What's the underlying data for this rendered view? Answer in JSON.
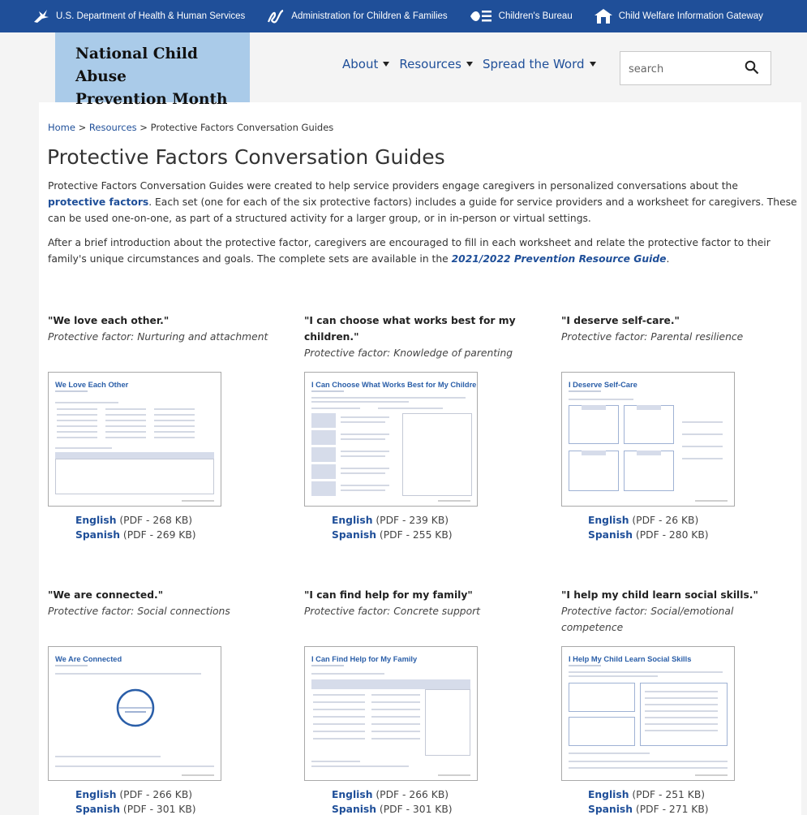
{
  "topbar": {
    "items": [
      {
        "label": "U.S. Department of Health & Human Services"
      },
      {
        "label": "Administration for Children & Families"
      },
      {
        "label": "Children's Bureau"
      },
      {
        "label": "Child Welfare Information Gateway"
      }
    ]
  },
  "site": {
    "title_line1": "National Child Abuse",
    "title_line2": "Prevention Month"
  },
  "nav": {
    "items": [
      {
        "label": "About"
      },
      {
        "label": "Resources"
      },
      {
        "label": "Spread the Word"
      }
    ]
  },
  "search": {
    "placeholder": "search"
  },
  "breadcrumb": {
    "home": "Home",
    "sep1": " > ",
    "resources": "Resources",
    "sep2": " > ",
    "current": "Protective Factors Conversation Guides"
  },
  "page": {
    "title": "Protective Factors Conversation Guides",
    "intro1_a": "Protective Factors Conversation Guides were created to help service providers engage caregivers in personalized conversations about the ",
    "intro1_link": "protective factors",
    "intro1_b": ". Each set (one for each of the six protective factors) includes a guide for service providers and a worksheet for caregivers. These can be used one-on-one, as part of a structured activity for a larger group, or in in-person or virtual settings.",
    "intro2_a": "After a brief introduction about the protective factor, caregivers are encouraged to fill in each worksheet and relate the protective factor to their family's unique circumstances and goals. The complete sets are available in the ",
    "intro2_link": "2021/2022 Prevention Resource Guide",
    "intro2_b": "."
  },
  "guides": [
    {
      "quote": "\"We love each other.\"",
      "factor": "Protective factor: Nurturing and attachment",
      "thumb_title": "We Love Each Other",
      "english": "English",
      "english_size": " (PDF - 268 KB)",
      "spanish": "Spanish",
      "spanish_size": " (PDF - 269 KB)"
    },
    {
      "quote": "\"I can choose what works best for my children.\"",
      "factor": "Protective factor: Knowledge of parenting",
      "thumb_title": "I Can Choose What Works Best for My Children",
      "english": "English",
      "english_size": " (PDF - 239 KB)",
      "spanish": "Spanish",
      "spanish_size": " (PDF - 255 KB)"
    },
    {
      "quote": "\"I deserve self-care.\"",
      "factor": "Protective factor: Parental resilience",
      "thumb_title": "I Deserve Self-Care",
      "english": "English",
      "english_size": " (PDF - 26 KB)",
      "spanish": "Spanish",
      "spanish_size": " (PDF - 280 KB)"
    },
    {
      "quote": "\"We are connected.\"",
      "factor": "Protective factor: Social connections",
      "thumb_title": "We Are Connected",
      "english": "English",
      "english_size": " (PDF - 266 KB)",
      "spanish": "Spanish",
      "spanish_size": " (PDF - 301 KB)"
    },
    {
      "quote": "\"I can find help for my family\"",
      "factor": "Protective factor: Concrete support",
      "thumb_title": "I Can Find Help for My Family",
      "english": "English",
      "english_size": " (PDF - 266 KB)",
      "spanish": "Spanish",
      "spanish_size": " (PDF - 301 KB)"
    },
    {
      "quote": "\"I help my child learn social skills.\"",
      "factor": "Protective factor: Social/emotional competence",
      "thumb_title": "I Help My Child Learn Social Skills",
      "english": "English",
      "english_size": " (PDF - 251 KB)",
      "spanish": "Spanish",
      "spanish_size": " (PDF - 271 KB)"
    }
  ],
  "colors": {
    "topbar": "#1f4f99",
    "link": "#1f4f99",
    "logo_bg": "#aacbe9"
  }
}
